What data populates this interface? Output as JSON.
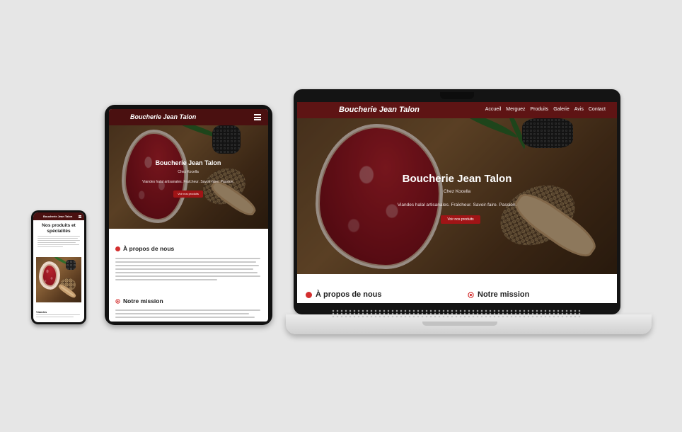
{
  "laptop": {
    "brand": "Boucherie Jean Talon",
    "nav": [
      "Accueil",
      "Merguez",
      "Produits",
      "Galerie",
      "Avis",
      "Contact"
    ],
    "hero": {
      "title": "Boucherie Jean Talon",
      "subtitle": "Chez Kocella",
      "tagline": "Viandes halal artisanales. Fraîcheur. Savoir-faire. Passion.",
      "button": "Voir nos produits"
    },
    "sections": [
      "À propos de nous",
      "Notre mission"
    ]
  },
  "tablet": {
    "brand": "Boucherie Jean Talon",
    "hero": {
      "title": "Boucherie Jean Talon",
      "subtitle": "Chez Kocella",
      "tagline": "Viandes halal artisanales. Fraîcheur. Savoir-faire. Passion.",
      "button": "Voir nos produits"
    },
    "about_title": "À propos de nous",
    "mission_title": "Notre mission"
  },
  "phone": {
    "brand": "Boucherie Jean Talon",
    "title": "Nos produits et spécialités",
    "caption": "Viandes"
  },
  "colors": {
    "header": "#5e1414",
    "accent": "#a01416",
    "icon": "#d32f2f"
  },
  "icons": [
    "menu-icon",
    "meat-icon",
    "target-icon"
  ]
}
